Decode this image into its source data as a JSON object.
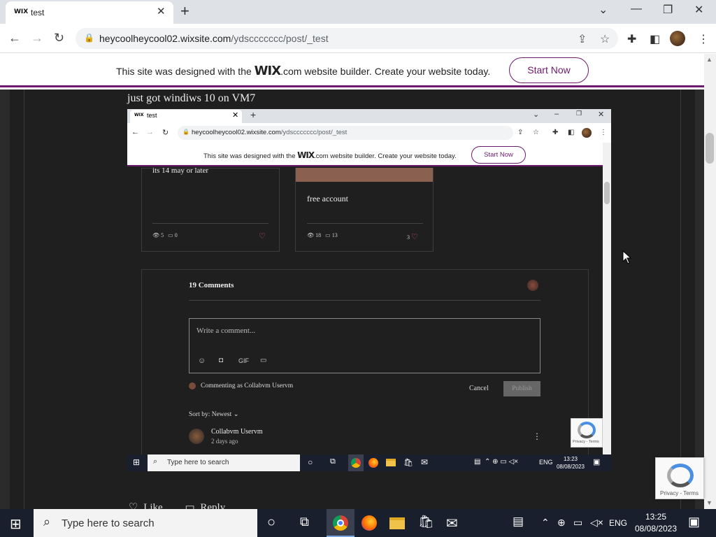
{
  "browser": {
    "tab_favicon": "WIX",
    "tab_title": "test",
    "url_host": "heycoolheycool02.wixsite.com",
    "url_path": "/ydsccccccc/post/_test"
  },
  "wix_banner": {
    "text_before": "This site was designed with the ",
    "brand": "WIX",
    "text_after": ".com website builder. Create your website today.",
    "start_now": "Start Now"
  },
  "post": {
    "title": "just got windiws 10 on VM7",
    "like_label": "Like",
    "reply_label": "Reply"
  },
  "recaptcha": {
    "label": "Privacy - Terms"
  },
  "inner": {
    "tab_favicon": "WIX",
    "tab_title": "test",
    "url_host": "heycoolheycool02.wixsite.com",
    "url_path": "/ydsccccccc/post/_test",
    "banner_text_before": "This site was designed with the ",
    "banner_brand": "WIX",
    "banner_text_after": ".com website builder. Create your website today.",
    "start_now": "Start Now",
    "card1": {
      "text": "its 14 may or later",
      "views": "5",
      "comments": "0"
    },
    "card2": {
      "title": "free account",
      "views": "18",
      "comments": "13",
      "likes": "3"
    },
    "comments_count": "19 Comments",
    "comment_placeholder": "Write a comment...",
    "gif_label": "GIF",
    "commenting_as": "Commenting as Collabvm Uservm",
    "cancel": "Cancel",
    "publish": "Publish",
    "sort_by": "Sort by: Newest",
    "comment_author": "Collabvm Uservm",
    "comment_time": "2 days ago",
    "recaptcha_label": "Privacy - Terms",
    "taskbar_search": "Type here to search",
    "tray_lang": "ENG",
    "time": "13:23",
    "date": "08/08/2023"
  },
  "taskbar": {
    "search_placeholder": "Type here to search",
    "lang": "ENG",
    "time": "13:25",
    "date": "08/08/2023"
  }
}
